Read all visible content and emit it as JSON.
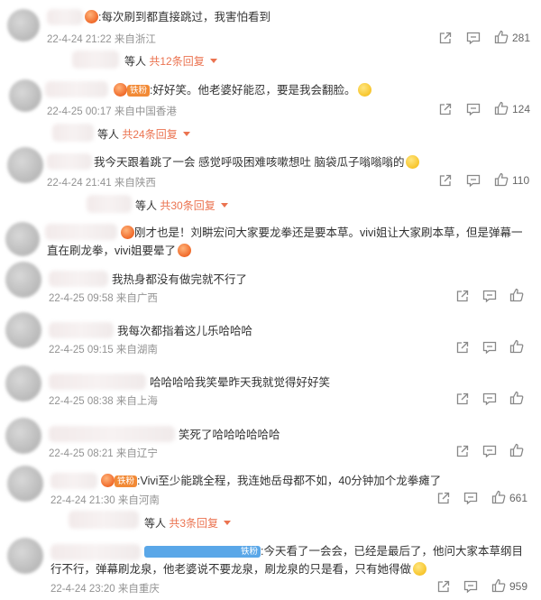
{
  "comments": [
    {
      "text": ":每次刷到都直接跳过，我害怕看到",
      "date": "22-4-24 21:22",
      "location": "来自浙江",
      "likes": "281"
    },
    {
      "badge": "铁粉",
      "text": ":好好笑。他老婆好能忍，要是我会翻脸。",
      "date": "22-4-25 00:17",
      "location": "来自中国香港",
      "likes": "124"
    },
    {
      "text": "我今天跟着跳了一会 感觉呼吸困难咳嗽想吐 脑袋瓜子嗡嗡嗡的",
      "date": "22-4-24 21:41",
      "location": "来自陕西",
      "likes": "110"
    },
    {
      "text": "刚才也是！刘畊宏问大家要龙拳还是要本草。vivi姐让大家刷本草，但是弹幕一直在刷龙拳，vivi姐要晕了"
    },
    {
      "text": "我热身都没有做完就不行了",
      "date": "22-4-25 09:58",
      "location": "来自广西"
    },
    {
      "text": "我每次都指着这儿乐哈哈哈",
      "date": "22-4-25 09:15",
      "location": "来自湖南"
    },
    {
      "text": "哈哈哈哈我笑晕昨天我就觉得好好笑",
      "date": "22-4-25 08:38",
      "location": "来自上海"
    },
    {
      "text": "笑死了哈哈哈哈哈哈",
      "date": "22-4-25 08:21",
      "location": "来自辽宁"
    },
    {
      "badge": "铁粉",
      "text": ":Vivi至少能跳全程，我连她岳母都不如，40分钟加个龙拳瘫了",
      "date": "22-4-24 21:30",
      "location": "来自河南",
      "likes": "661"
    },
    {
      "badge": "铁粉",
      "text": ":今天看了一会会，已经是最后了，他问大家本草纲目行不行，弹幕刷龙泉，他老婆说不要龙泉，刷龙泉的只是看，只有她得做",
      "date": "22-4-24 23:20",
      "location": "来自重庆",
      "likes": "959"
    }
  ],
  "replies": [
    {
      "prefix": "等人",
      "count": "共12条回复"
    },
    {
      "prefix": "等人",
      "count": "共24条回复"
    },
    {
      "prefix": "等人",
      "count": "共30条回复"
    },
    {
      "prefix": "等人",
      "count": "共3条回复"
    }
  ],
  "icons": {
    "share": "share-icon",
    "comment": "comment-icon",
    "like": "thumbs-up-icon"
  },
  "colors": {
    "accent": "#eb7350",
    "meta": "#939393"
  }
}
